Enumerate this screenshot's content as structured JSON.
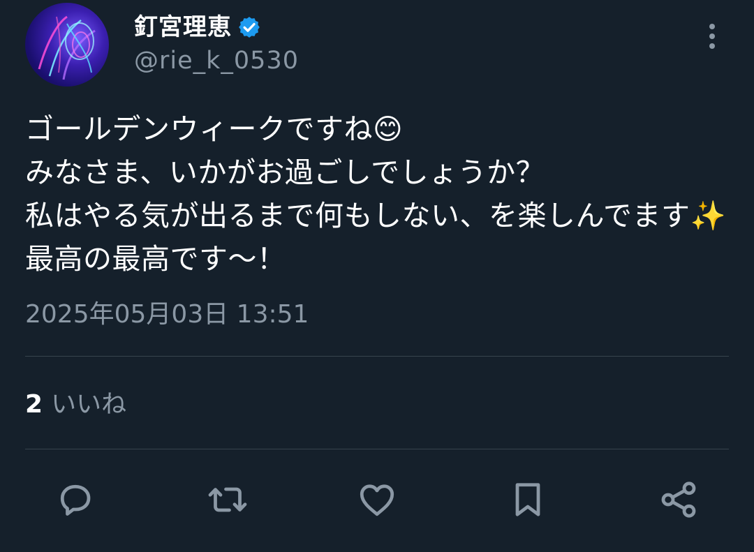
{
  "author": {
    "display_name": "釘宮理恵",
    "handle": "@rie_k_0530",
    "verified_icon": "verified-badge-icon",
    "avatar_icon": "avatar-abstract-light-icon"
  },
  "tweet": {
    "text": "ゴールデンウィークですね😊\nみなさま、いかがお過ごしでしょうか？\n私はやる気が出るまで何もしない、を楽しんでます✨最高の最高です〜！",
    "timestamp": "2025年05月03日 13:51"
  },
  "stats": {
    "likes_count": "2",
    "likes_label": "いいね"
  },
  "actions": {
    "reply_icon": "reply-icon",
    "retweet_icon": "retweet-icon",
    "like_icon": "heart-icon",
    "bookmark_icon": "bookmark-icon",
    "share_icon": "share-icon",
    "more_icon": "more-vertical-icon"
  },
  "colors": {
    "background": "#15202b",
    "primary_text": "#ffffff",
    "secondary_text": "#8b98a5",
    "divider": "#38444d",
    "verified_blue": "#1d9bf0"
  }
}
